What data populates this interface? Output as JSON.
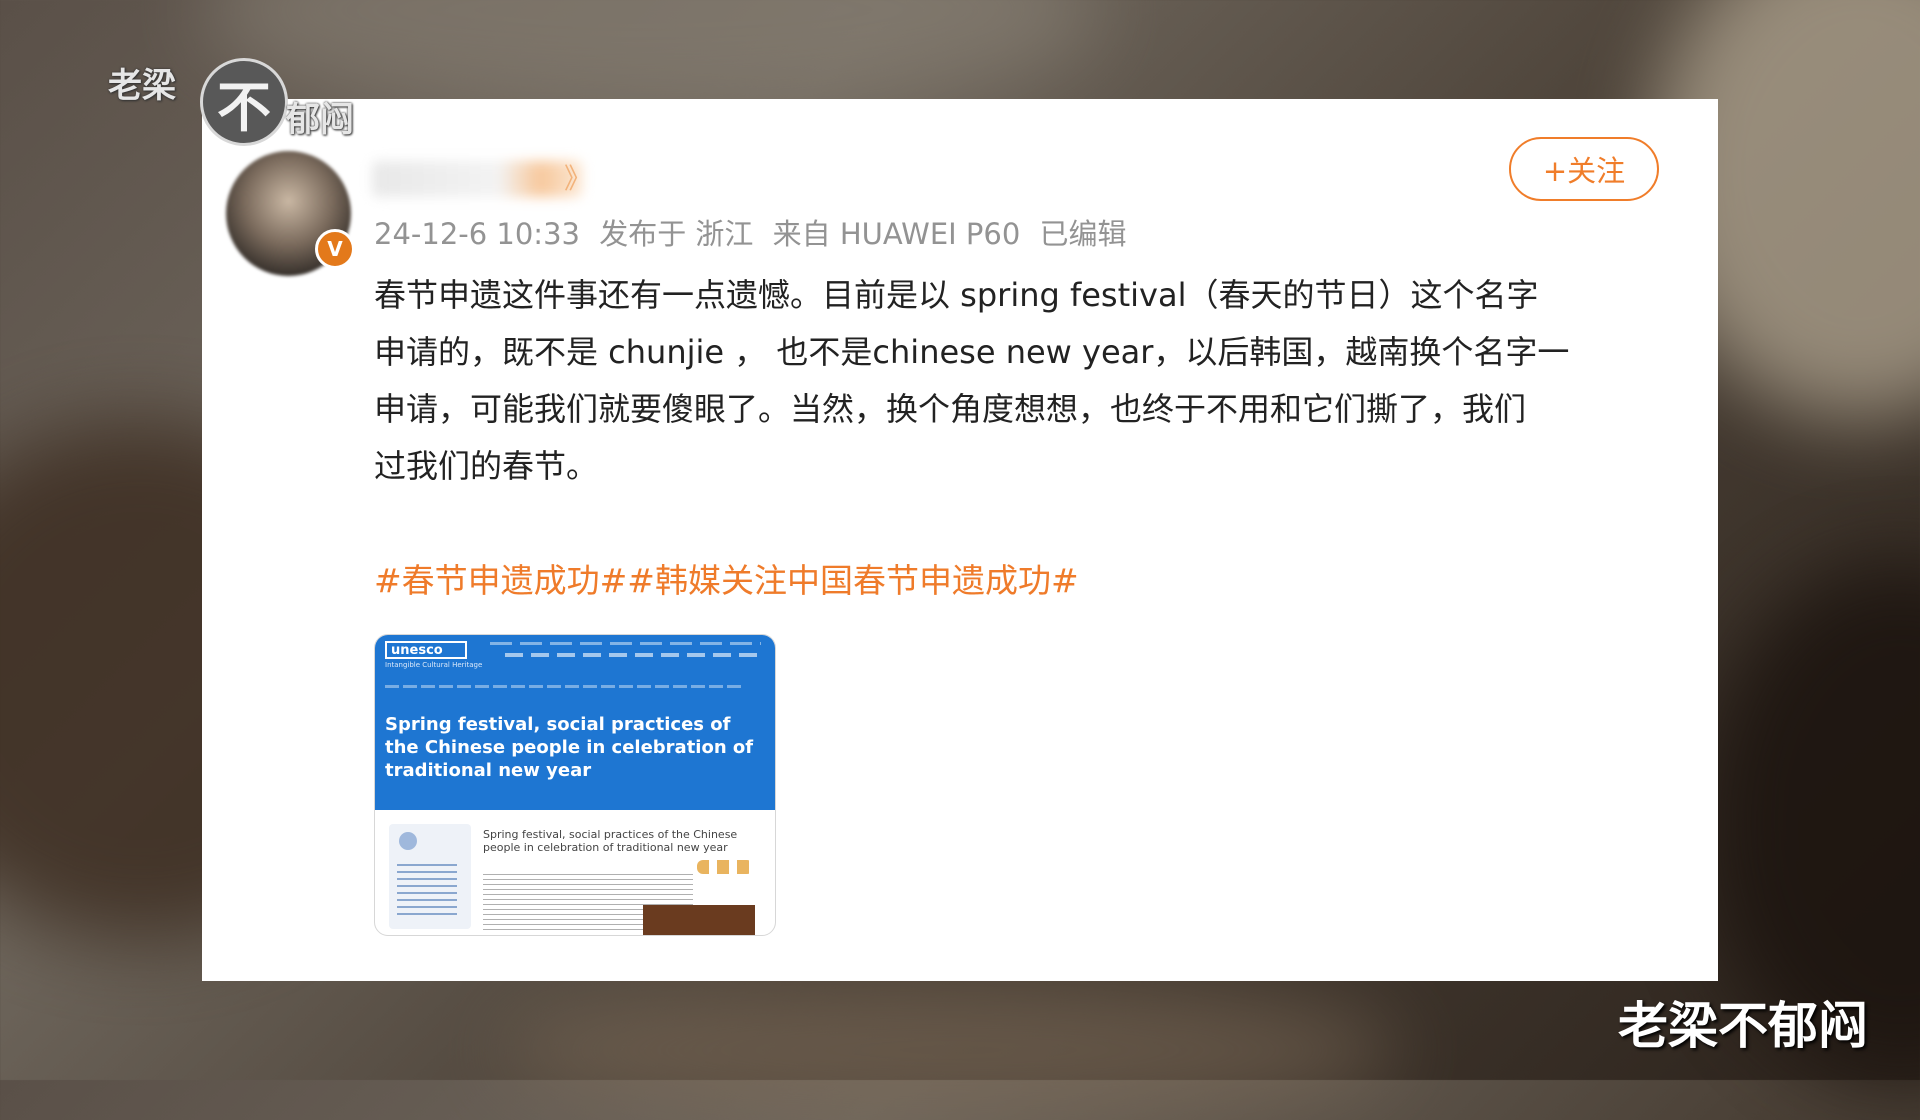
{
  "watermark": {
    "left_text": "老梁",
    "circle_char": "不",
    "right_text": "郁闷",
    "bottom_right": "老梁不郁闷"
  },
  "post": {
    "follow_label": "+关注",
    "meta": {
      "time": "24-12-6 10:33",
      "location": "发布于 浙江",
      "device": "来自 HUAWEI P60",
      "edited": "已编辑"
    },
    "text_lines": [
      "春节申遗这件事还有一点遗憾。目前是以 spring festival（春天的节日）这个名字",
      "申请的，既不是 chunjie ，  也不是chinese new year，以后韩国，越南换个名字一",
      "申请，可能我们就要傻眼了。当然，换个角度想想，也终于不用和它们撕了，我们",
      "过我们的春节。"
    ],
    "hashtags": "#春节申遗成功##韩媒关注中国春节申遗成功#",
    "verified_badge": "V",
    "name_chevron": "》"
  },
  "thumbnail": {
    "logo": "unesco",
    "logo_sub": "Intangible Cultural Heritage",
    "title": "Spring festival, social practices of the Chinese people in celebration of traditional new year",
    "subtitle": "Spring festival, social practices of the Chinese people in celebration of traditional new year"
  },
  "colors": {
    "accent": "#ef7b2a",
    "meta_gray": "#939393",
    "unesco_blue": "#1e76d2"
  }
}
